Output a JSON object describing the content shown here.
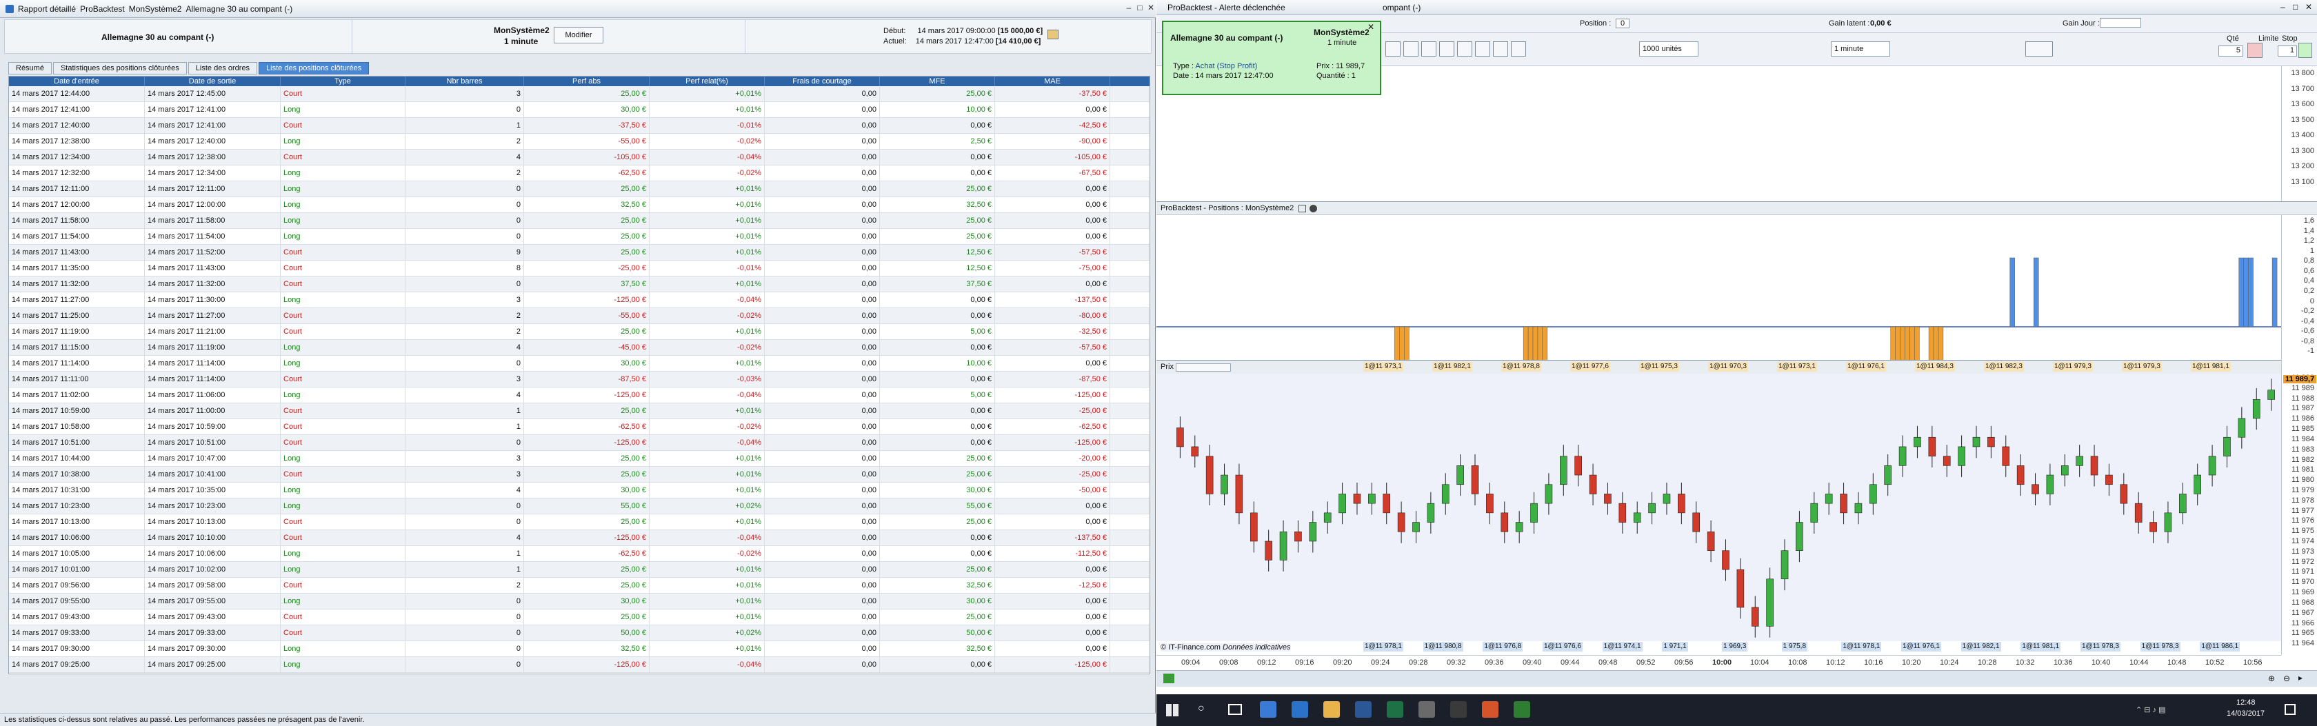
{
  "left_window": {
    "title_parts": [
      "Rapport détaillé",
      "ProBacktest",
      "MonSystème2",
      "Allemagne 30 au compant (-)"
    ],
    "instrument": "Allemagne 30 au compant (-)",
    "system_name": "MonSystème2",
    "timeframe": "1 minute",
    "modify_button": "Modifier",
    "start_label": "Début:",
    "start_value": "14 mars 2017 09:00:00",
    "start_capital": "[15 000,00 €]",
    "current_label": "Actuel:",
    "current_value": "14 mars 2017 12:47:00",
    "current_capital": "[14 410,00 €]",
    "tabs": [
      "Résumé",
      "Statistiques des positions clôturées",
      "Liste des ordres",
      "Liste des positions clôturées"
    ],
    "active_tab": 3,
    "columns": [
      "Date d'entrée",
      "Date de sortie",
      "Type",
      "Nbr barres",
      "Perf abs",
      "Perf relat(%)",
      "Frais de courtage",
      "MFE",
      "MAE"
    ],
    "rows": [
      [
        "14 mars 2017 12:44:00",
        "14 mars 2017 12:45:00",
        "Court",
        "3",
        "25,00 €",
        "+0,01%",
        "0,00",
        "25,00 €",
        "-37,50 €"
      ],
      [
        "14 mars 2017 12:41:00",
        "14 mars 2017 12:41:00",
        "Long",
        "0",
        "30,00 €",
        "+0,01%",
        "0,00",
        "10,00 €",
        "0,00 €"
      ],
      [
        "14 mars 2017 12:40:00",
        "14 mars 2017 12:41:00",
        "Court",
        "1",
        "-37,50 €",
        "-0,01%",
        "0,00",
        "0,00 €",
        "-42,50 €"
      ],
      [
        "14 mars 2017 12:38:00",
        "14 mars 2017 12:40:00",
        "Long",
        "2",
        "-55,00 €",
        "-0,02%",
        "0,00",
        "2,50 €",
        "-90,00 €"
      ],
      [
        "14 mars 2017 12:34:00",
        "14 mars 2017 12:38:00",
        "Court",
        "4",
        "-105,00 €",
        "-0,04%",
        "0,00",
        "0,00 €",
        "-105,00 €"
      ],
      [
        "14 mars 2017 12:32:00",
        "14 mars 2017 12:34:00",
        "Long",
        "2",
        "-62,50 €",
        "-0,02%",
        "0,00",
        "0,00 €",
        "-67,50 €"
      ],
      [
        "14 mars 2017 12:11:00",
        "14 mars 2017 12:11:00",
        "Long",
        "0",
        "25,00 €",
        "+0,01%",
        "0,00",
        "25,00 €",
        "0,00 €"
      ],
      [
        "14 mars 2017 12:00:00",
        "14 mars 2017 12:00:00",
        "Long",
        "0",
        "32,50 €",
        "+0,01%",
        "0,00",
        "32,50 €",
        "0,00 €"
      ],
      [
        "14 mars 2017 11:58:00",
        "14 mars 2017 11:58:00",
        "Long",
        "0",
        "25,00 €",
        "+0,01%",
        "0,00",
        "25,00 €",
        "0,00 €"
      ],
      [
        "14 mars 2017 11:54:00",
        "14 mars 2017 11:54:00",
        "Long",
        "0",
        "25,00 €",
        "+0,01%",
        "0,00",
        "25,00 €",
        "0,00 €"
      ],
      [
        "14 mars 2017 11:43:00",
        "14 mars 2017 11:52:00",
        "Court",
        "9",
        "25,00 €",
        "+0,01%",
        "0,00",
        "12,50 €",
        "-57,50 €"
      ],
      [
        "14 mars 2017 11:35:00",
        "14 mars 2017 11:43:00",
        "Court",
        "8",
        "-25,00 €",
        "-0,01%",
        "0,00",
        "12,50 €",
        "-75,00 €"
      ],
      [
        "14 mars 2017 11:32:00",
        "14 mars 2017 11:32:00",
        "Court",
        "0",
        "37,50 €",
        "+0,01%",
        "0,00",
        "37,50 €",
        "0,00 €"
      ],
      [
        "14 mars 2017 11:27:00",
        "14 mars 2017 11:30:00",
        "Long",
        "3",
        "-125,00 €",
        "-0,04%",
        "0,00",
        "0,00 €",
        "-137,50 €"
      ],
      [
        "14 mars 2017 11:25:00",
        "14 mars 2017 11:27:00",
        "Court",
        "2",
        "-55,00 €",
        "-0,02%",
        "0,00",
        "0,00 €",
        "-80,00 €"
      ],
      [
        "14 mars 2017 11:19:00",
        "14 mars 2017 11:21:00",
        "Court",
        "2",
        "25,00 €",
        "+0,01%",
        "0,00",
        "5,00 €",
        "-32,50 €"
      ],
      [
        "14 mars 2017 11:15:00",
        "14 mars 2017 11:19:00",
        "Long",
        "4",
        "-45,00 €",
        "-0,02%",
        "0,00",
        "0,00 €",
        "-57,50 €"
      ],
      [
        "14 mars 2017 11:14:00",
        "14 mars 2017 11:14:00",
        "Long",
        "0",
        "30,00 €",
        "+0,01%",
        "0,00",
        "10,00 €",
        "0,00 €"
      ],
      [
        "14 mars 2017 11:11:00",
        "14 mars 2017 11:14:00",
        "Court",
        "3",
        "-87,50 €",
        "-0,03%",
        "0,00",
        "0,00 €",
        "-87,50 €"
      ],
      [
        "14 mars 2017 11:02:00",
        "14 mars 2017 11:06:00",
        "Long",
        "4",
        "-125,00 €",
        "-0,04%",
        "0,00",
        "5,00 €",
        "-125,00 €"
      ],
      [
        "14 mars 2017 10:59:00",
        "14 mars 2017 11:00:00",
        "Court",
        "1",
        "25,00 €",
        "+0,01%",
        "0,00",
        "0,00 €",
        "-25,00 €"
      ],
      [
        "14 mars 2017 10:58:00",
        "14 mars 2017 10:59:00",
        "Court",
        "1",
        "-62,50 €",
        "-0,02%",
        "0,00",
        "0,00 €",
        "-62,50 €"
      ],
      [
        "14 mars 2017 10:51:00",
        "14 mars 2017 10:51:00",
        "Court",
        "0",
        "-125,00 €",
        "-0,04%",
        "0,00",
        "0,00 €",
        "-125,00 €"
      ],
      [
        "14 mars 2017 10:44:00",
        "14 mars 2017 10:47:00",
        "Long",
        "3",
        "25,00 €",
        "+0,01%",
        "0,00",
        "25,00 €",
        "-20,00 €"
      ],
      [
        "14 mars 2017 10:38:00",
        "14 mars 2017 10:41:00",
        "Court",
        "3",
        "25,00 €",
        "+0,01%",
        "0,00",
        "25,00 €",
        "-25,00 €"
      ],
      [
        "14 mars 2017 10:31:00",
        "14 mars 2017 10:35:00",
        "Long",
        "4",
        "30,00 €",
        "+0,01%",
        "0,00",
        "30,00 €",
        "-50,00 €"
      ],
      [
        "14 mars 2017 10:23:00",
        "14 mars 2017 10:23:00",
        "Long",
        "0",
        "55,00 €",
        "+0,02%",
        "0,00",
        "55,00 €",
        "0,00 €"
      ],
      [
        "14 mars 2017 10:13:00",
        "14 mars 2017 10:13:00",
        "Court",
        "0",
        "25,00 €",
        "+0,01%",
        "0,00",
        "25,00 €",
        "0,00 €"
      ],
      [
        "14 mars 2017 10:06:00",
        "14 mars 2017 10:10:00",
        "Court",
        "4",
        "-125,00 €",
        "-0,04%",
        "0,00",
        "0,00 €",
        "-137,50 €"
      ],
      [
        "14 mars 2017 10:05:00",
        "14 mars 2017 10:06:00",
        "Long",
        "1",
        "-62,50 €",
        "-0,02%",
        "0,00",
        "0,00 €",
        "-112,50 €"
      ],
      [
        "14 mars 2017 10:01:00",
        "14 mars 2017 10:02:00",
        "Long",
        "1",
        "25,00 €",
        "+0,01%",
        "0,00",
        "25,00 €",
        "0,00 €"
      ],
      [
        "14 mars 2017 09:56:00",
        "14 mars 2017 09:58:00",
        "Court",
        "2",
        "25,00 €",
        "+0,01%",
        "0,00",
        "32,50 €",
        "-12,50 €"
      ],
      [
        "14 mars 2017 09:55:00",
        "14 mars 2017 09:55:00",
        "Long",
        "0",
        "30,00 €",
        "+0,01%",
        "0,00",
        "30,00 €",
        "0,00 €"
      ],
      [
        "14 mars 2017 09:43:00",
        "14 mars 2017 09:43:00",
        "Court",
        "0",
        "25,00 €",
        "+0,01%",
        "0,00",
        "25,00 €",
        "0,00 €"
      ],
      [
        "14 mars 2017 09:33:00",
        "14 mars 2017 09:33:00",
        "Court",
        "0",
        "50,00 €",
        "+0,02%",
        "0,00",
        "50,00 €",
        "0,00 €"
      ],
      [
        "14 mars 2017 09:30:00",
        "14 mars 2017 09:30:00",
        "Long",
        "0",
        "32,50 €",
        "+0,01%",
        "0,00",
        "32,50 €",
        "0,00 €"
      ],
      [
        "14 mars 2017 09:25:00",
        "14 mars 2017 09:25:00",
        "Long",
        "0",
        "-125,00 €",
        "-0,04%",
        "0,00",
        "0,00 €",
        "-125,00 €"
      ]
    ],
    "status_text": "Les statistiques ci-dessus sont relatives au passé. Les performances passées ne présagent pas de l'avenir."
  },
  "right_window": {
    "title": "ProBacktest - Alerte déclenchée",
    "title_suffix": "ompant (-)",
    "position_label": "Position :",
    "position_value": "0",
    "latent_label": "Gain latent :",
    "latent_value": "0,00 €",
    "day_gain_label": "Gain Jour :",
    "qty_label": "Qté",
    "qty_value": "5",
    "limit_label": "Limite",
    "stop_label": "Stop",
    "one_value": "1",
    "units_select": "1000 unités",
    "interval_select": "1 minute",
    "popup": {
      "instrument": "Allemagne 30 au compant (-)",
      "system": "MonSystème2",
      "timeframe": "1 minute",
      "type_label": "Type :",
      "type_value": "Achat (Stop Profit)",
      "price_label": "Prix :",
      "price_value": "11 989,7",
      "date_label": "Date :",
      "date_value": "14 mars 2017 12:47:00",
      "qty_label": "Quantité :",
      "qty_value": "1"
    },
    "pane2_title": "ProBacktest - Positions : MonSystème2",
    "pane3_title": "Prix",
    "source_label": "© IT-Finance.com",
    "source_italic": "Données indicatives",
    "clock_time": "12:48",
    "clock_date": "14/03/2017"
  },
  "chart_data": [
    {
      "type": "line",
      "title": "",
      "xlabel": "",
      "ylabel": "",
      "y_ticks": [
        "13 800",
        "13 700",
        "13 600",
        "13 500",
        "13 400",
        "13 300",
        "13 200",
        "13 100"
      ]
    },
    {
      "type": "bar",
      "title": "ProBacktest - Positions : MonSystème2",
      "y_ticks": [
        "1,6",
        "1,4",
        "1,2",
        "1",
        "0,8",
        "0,6",
        "0,4",
        "0,2",
        "0",
        "-0,2",
        "-0,4",
        "-0,6",
        "-0,8",
        "-1"
      ],
      "series": [
        {
          "name": "long",
          "color": "#4f8fe6",
          "x": [
            "11:52",
            "11:57",
            "12:40",
            "12:41",
            "12:42",
            "12:47"
          ],
          "values": [
            1,
            1,
            1,
            1,
            1,
            1
          ]
        },
        {
          "name": "short",
          "color": "#f0a030",
          "x": [
            "09:43",
            "09:44",
            "09:45",
            "10:10",
            "10:11",
            "10:12",
            "10:13",
            "10:14",
            "11:27",
            "11:28",
            "11:29",
            "11:30",
            "11:31",
            "11:32",
            "11:35",
            "11:36",
            "11:37"
          ],
          "values": [
            -1,
            -1,
            -1,
            -1,
            -1,
            -1,
            -1,
            -1,
            -1,
            -1,
            -1,
            -1,
            -1,
            -1,
            -1,
            -1,
            -1
          ]
        }
      ],
      "ylim": [
        -1,
        1.6
      ]
    },
    {
      "type": "candlestick",
      "title": "Prix",
      "y_ticks": [
        "11 990",
        "11 989",
        "11 988",
        "11 987",
        "11 986",
        "11 985",
        "11 984",
        "11 983",
        "11 982",
        "11 981",
        "11 980",
        "11 979",
        "11 978",
        "11 977",
        "11 976",
        "11 975",
        "11 974",
        "11 973",
        "11 972",
        "11 971",
        "11 970",
        "11 969",
        "11 968",
        "11 967",
        "11 966",
        "11 965",
        "11 964"
      ],
      "last_price": "11 989,7",
      "x_ticks": [
        "09:04",
        "09:08",
        "09:12",
        "09:16",
        "09:20",
        "09:24",
        "09:28",
        "09:32",
        "09:36",
        "09:40",
        "09:44",
        "09:48",
        "09:52",
        "09:56",
        "10:00",
        "10:04",
        "10:08",
        "10:12",
        "10:16",
        "10:20",
        "10:24",
        "10:28",
        "10:32",
        "10:36",
        "10:40",
        "10:44",
        "10:48",
        "10:52",
        "10:56"
      ],
      "trade_labels_top": [
        "1@11 973,1",
        "1@11 982,1",
        "1@11 978,8",
        "1@11 977,6",
        "1@11 975,3",
        "1@11 970,3",
        "1@11 973,1",
        "1@11 976,1",
        "1@11 984,3",
        "1@11 982,3",
        "1@11 979,3",
        "1@11 979,3",
        "1@11 981,1"
      ],
      "trade_labels_bottom": [
        "1@11 978,1",
        "1@11 980,8",
        "1@11 976,8",
        "1@11 976,6",
        "1@11 974,1",
        "1 971,1",
        "1 969,3",
        "1 975,8",
        "1@11 978,1",
        "1@11 976,1",
        "1@11 982,1",
        "1@11 981,1",
        "1@11 978,3",
        "1@11 978,3",
        "1@11 986,1"
      ],
      "closes": [
        11985,
        11983,
        11982,
        11978,
        11980,
        11976,
        11973,
        11971,
        11974,
        11973,
        11975,
        11976,
        11978,
        11977,
        11978,
        11976,
        11974,
        11975,
        11977,
        11979,
        11981,
        11978,
        11976,
        11974,
        11975,
        11977,
        11979,
        11982,
        11980,
        11978,
        11977,
        11975,
        11976,
        11977,
        11978,
        11976,
        11974,
        11972,
        11970,
        11966,
        11964,
        11969,
        11972,
        11975,
        11977,
        11978,
        11976,
        11977,
        11979,
        11981,
        11983,
        11984,
        11982,
        11981,
        11983,
        11984,
        11983,
        11981,
        11979,
        11978,
        11980,
        11981,
        11982,
        11980,
        11979,
        11977,
        11975,
        11974,
        11976,
        11978,
        11980,
        11982,
        11984,
        11986,
        11988,
        11989
      ]
    }
  ]
}
